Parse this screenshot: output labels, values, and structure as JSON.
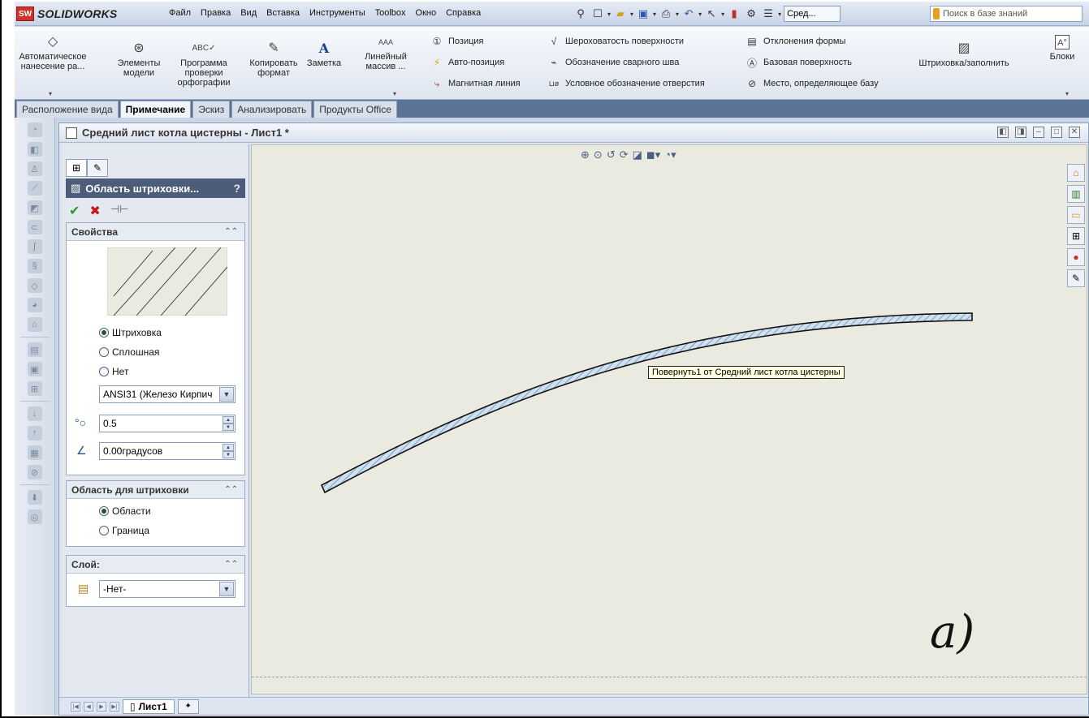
{
  "app": {
    "logo_mark": "SW",
    "name": "SOLIDWORKS"
  },
  "menu": [
    "Файл",
    "Правка",
    "Вид",
    "Вставка",
    "Инструменты",
    "Toolbox",
    "Окно",
    "Справка"
  ],
  "quick_access": {
    "dropdown_value": "Сред..."
  },
  "search": {
    "placeholder": "Поиск в базе знаний"
  },
  "ribbon": {
    "buttons": [
      {
        "label": "Автоматическое нанесение ра..."
      },
      {
        "label": "Элементы модели"
      },
      {
        "label": "Программа проверки орфографии"
      },
      {
        "label": "Копировать формат"
      },
      {
        "label": "Заметка"
      },
      {
        "label": "Линейный массив ..."
      }
    ],
    "col1": [
      "Позиция",
      "Авто-позиция",
      "Магнитная линия"
    ],
    "col2": [
      "Шероховатость поверхности",
      "Обозначение сварного шва",
      "Условное обозначение отверстия"
    ],
    "col3": [
      "Отклонения формы",
      "Базовая поверхность",
      "Место, определяющее базу"
    ],
    "hatch_fill": "Штриховка/заполнить",
    "blocks": "Блоки"
  },
  "tabs": [
    "Расположение вида",
    "Примечание",
    "Эскиз",
    "Анализировать",
    "Продукты Office"
  ],
  "document": {
    "title": "Средний лист котла цистерны - Лист1 *"
  },
  "property_manager": {
    "title": "Область штриховки...",
    "help": "?",
    "properties": {
      "header": "Свойства",
      "options": [
        "Штриховка",
        "Сплошная",
        "Нет"
      ],
      "selected": 0,
      "pattern": "ANSI31 (Железо Кирпич",
      "scale": "0.5",
      "angle": "0.00градусов"
    },
    "area": {
      "header": "Область для штриховки",
      "options": [
        "Области",
        "Граница"
      ],
      "selected": 0
    },
    "layer": {
      "header": "Слой:",
      "value": "-Нет-"
    }
  },
  "graphics": {
    "tooltip": "Повернуть1 от Средний лист котла цистерны",
    "annotation": "a)"
  },
  "sheet_tab": {
    "label": "Лист1"
  },
  "colors": {
    "hatch_fill": "#cfe0ef",
    "hatch_line": "#6c8fb5",
    "viewport": "#eaeae0",
    "title_bar": "#4b5d79"
  },
  "icons": [
    "hatch-icon",
    "ok-check-icon",
    "cancel-x-icon",
    "pin-icon",
    "zoom-icon",
    "home-icon",
    "folder-icon",
    "appearance-icon"
  ]
}
